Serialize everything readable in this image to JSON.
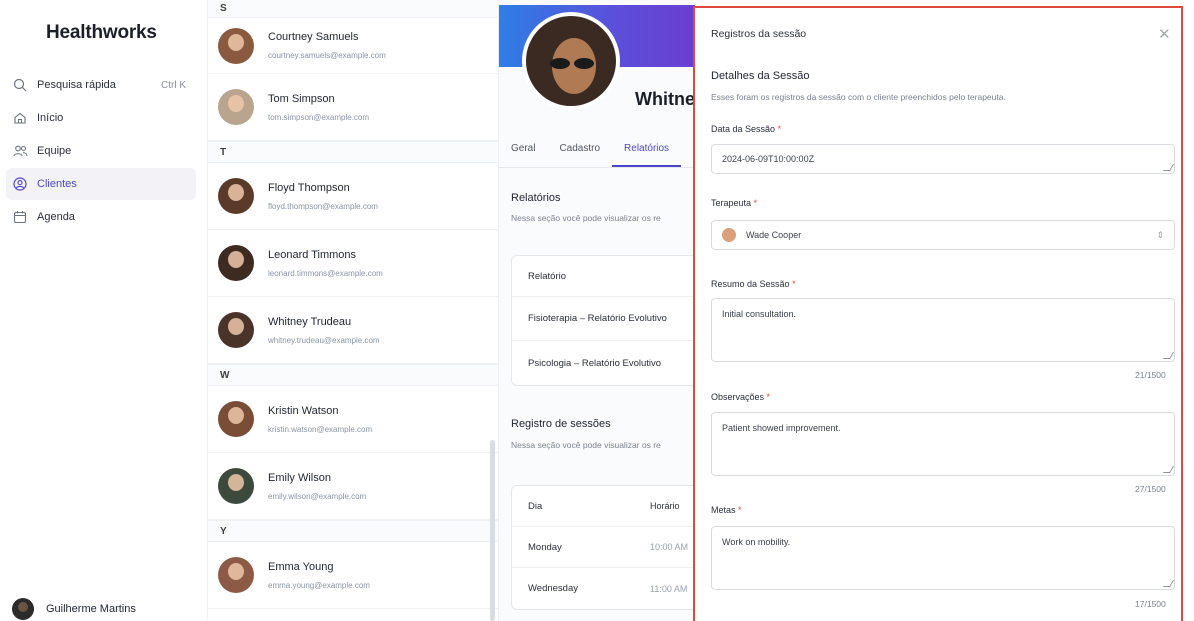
{
  "sidebar": {
    "brand": "Healthworks",
    "items": [
      {
        "label": "Pesquisa rápida",
        "icon": "search-icon",
        "shortcut": "Ctrl K"
      },
      {
        "label": "Início",
        "icon": "home-icon"
      },
      {
        "label": "Equipe",
        "icon": "team-icon"
      },
      {
        "label": "Clientes",
        "icon": "user-circle-icon",
        "active": true
      },
      {
        "label": "Agenda",
        "icon": "calendar-icon"
      }
    ],
    "user": {
      "name": "Guilherme Martins"
    }
  },
  "clients": {
    "groups": [
      {
        "letter": "S",
        "items": [
          {
            "name": "Courtney Samuels",
            "email": "courtney.samuels@example.com",
            "color": "#8a5a40"
          },
          {
            "name": "Tom Simpson",
            "email": "tom.simpson@example.com",
            "color": "#b9a48e"
          }
        ]
      },
      {
        "letter": "T",
        "items": [
          {
            "name": "Floyd Thompson",
            "email": "floyd.thompson@example.com",
            "color": "#5b3a2a"
          },
          {
            "name": "Leonard Timmons",
            "email": "leonard.timmons@example.com",
            "color": "#3d2b22"
          },
          {
            "name": "Whitney Trudeau",
            "email": "whitney.trudeau@example.com",
            "color": "#4a3328"
          }
        ]
      },
      {
        "letter": "W",
        "items": [
          {
            "name": "Kristin Watson",
            "email": "kristin.watson@example.com",
            "color": "#7a4d36"
          },
          {
            "name": "Emily Wilson",
            "email": "emily.wilson@example.com",
            "color": "#3c4a3e"
          }
        ]
      },
      {
        "letter": "Y",
        "items": [
          {
            "name": "Emma Young",
            "email": "emma.young@example.com",
            "color": "#8d5b45"
          }
        ]
      }
    ]
  },
  "profile": {
    "name": "Whitney",
    "tabs": [
      "Geral",
      "Cadastro",
      "Relatórios"
    ],
    "active_tab": "Relatórios",
    "reports": {
      "title": "Relatórios",
      "subtitle": "Nessa seção você pode visualizar os re",
      "column": "Relatório",
      "rows": [
        "Fisioterapia – Relatório Evolutivo",
        "Psicologia – Relatório Evolutivo"
      ]
    },
    "sessions": {
      "title": "Registro de sessões",
      "subtitle": "Nessa seção você pode visualizar os re",
      "columns": [
        "Dia",
        "Horário"
      ],
      "rows": [
        {
          "day": "Monday",
          "time": "10:00 AM"
        },
        {
          "day": "Wednesday",
          "time": "11:00 AM"
        }
      ]
    }
  },
  "drawer": {
    "header": "Registros da sessão",
    "title": "Detalhes da Sessão",
    "subtitle": "Esses foram os registros da sessão com o cliente preenchidos pelo terapeuta.",
    "fields": {
      "date": {
        "label": "Data da Sessão",
        "value": "2024-06-09T10:00:00Z"
      },
      "therapist": {
        "label": "Terapeuta",
        "value": "Wade Cooper"
      },
      "summary": {
        "label": "Resumo da Sessão",
        "value": "Initial consultation.",
        "count": "21/1500"
      },
      "observations": {
        "label": "Observações",
        "value": "Patient showed improvement.",
        "count": "27/1500"
      },
      "goals": {
        "label": "Metas",
        "value": "Work on mobility.",
        "count": "17/1500"
      }
    },
    "required_mark": "*"
  },
  "colors": {
    "accent": "#4b46c9",
    "required": "#e2483d",
    "drawer_border": "#e2483d"
  }
}
